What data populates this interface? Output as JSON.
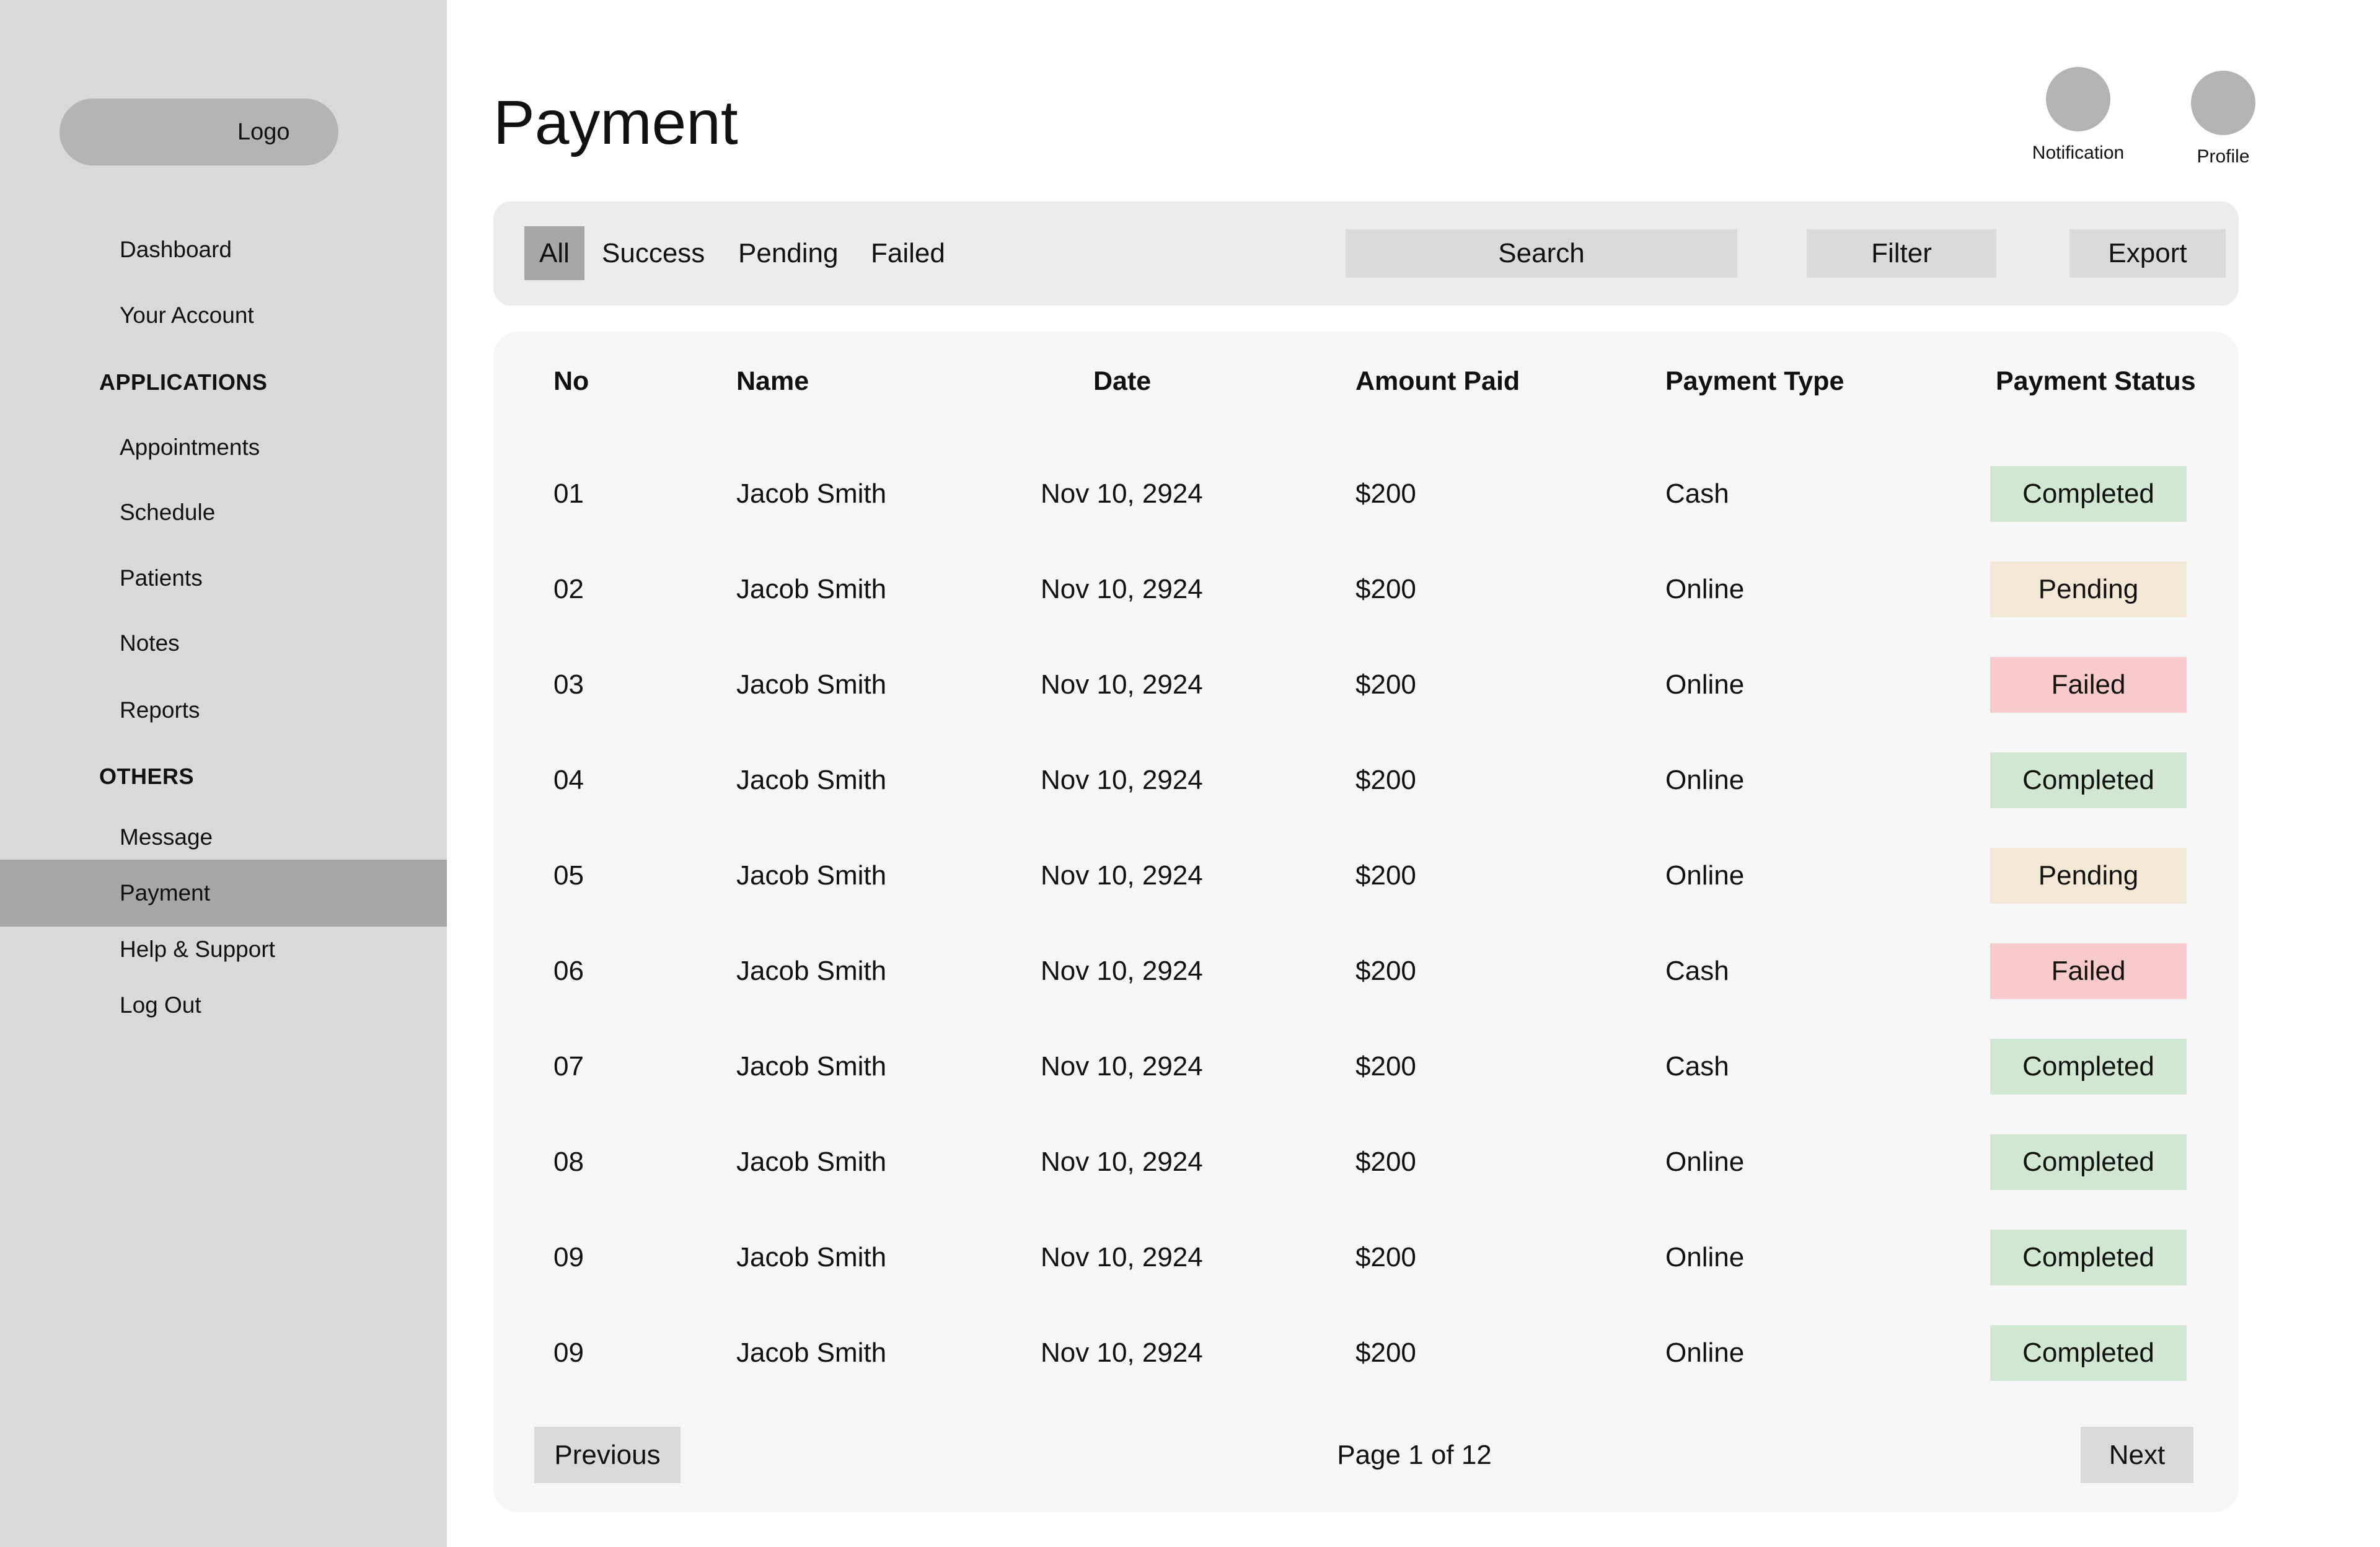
{
  "sidebar": {
    "logo": "Logo",
    "items": [
      {
        "label": "Dashboard"
      },
      {
        "label": "Your Account"
      },
      {
        "label": "Appointments"
      },
      {
        "label": "Schedule"
      },
      {
        "label": "Patients"
      },
      {
        "label": "Notes"
      },
      {
        "label": "Reports"
      },
      {
        "label": "Message"
      },
      {
        "label": "Payment",
        "active": true
      },
      {
        "label": "Help & Support"
      },
      {
        "label": "Log Out"
      }
    ],
    "sections": {
      "applications": "APPLICATIONS",
      "others": "OTHERS"
    }
  },
  "header": {
    "title": "Payment",
    "notification_label": "Notification",
    "profile_label": "Profile"
  },
  "toolbar": {
    "tabs": [
      {
        "label": "All",
        "active": true
      },
      {
        "label": "Success"
      },
      {
        "label": "Pending"
      },
      {
        "label": "Failed"
      }
    ],
    "search_label": "Search",
    "filter_label": "Filter",
    "export_label": "Export"
  },
  "table": {
    "columns": [
      "No",
      "Name",
      "Date",
      "Amount Paid",
      "Payment Type",
      "Payment Status"
    ],
    "rows": [
      {
        "no": "01",
        "name": "Jacob Smith",
        "date": "Nov 10, 2924",
        "amount": "$200",
        "type": "Cash",
        "status": "Completed"
      },
      {
        "no": "02",
        "name": "Jacob Smith",
        "date": "Nov 10, 2924",
        "amount": "$200",
        "type": "Online",
        "status": "Pending"
      },
      {
        "no": "03",
        "name": "Jacob Smith",
        "date": "Nov 10, 2924",
        "amount": "$200",
        "type": "Online",
        "status": "Failed"
      },
      {
        "no": "04",
        "name": "Jacob Smith",
        "date": "Nov 10, 2924",
        "amount": "$200",
        "type": "Online",
        "status": "Completed"
      },
      {
        "no": "05",
        "name": "Jacob Smith",
        "date": "Nov 10, 2924",
        "amount": "$200",
        "type": "Online",
        "status": "Pending"
      },
      {
        "no": "06",
        "name": "Jacob Smith",
        "date": "Nov 10, 2924",
        "amount": "$200",
        "type": "Cash",
        "status": "Failed"
      },
      {
        "no": "07",
        "name": "Jacob Smith",
        "date": "Nov 10, 2924",
        "amount": "$200",
        "type": "Cash",
        "status": "Completed"
      },
      {
        "no": "08",
        "name": "Jacob Smith",
        "date": "Nov 10, 2924",
        "amount": "$200",
        "type": "Online",
        "status": "Completed"
      },
      {
        "no": "09",
        "name": "Jacob Smith",
        "date": "Nov 10, 2924",
        "amount": "$200",
        "type": "Online",
        "status": "Completed"
      },
      {
        "no": "09",
        "name": "Jacob Smith",
        "date": "Nov 10, 2924",
        "amount": "$200",
        "type": "Online",
        "status": "Completed"
      }
    ]
  },
  "pagination": {
    "previous_label": "Previous",
    "page_text": "Page 1 of 12",
    "next_label": "Next"
  },
  "colors": {
    "sidebar_bg": "#d9d9d9",
    "sidebar_active": "#a6a6a6",
    "status_completed": "#d1e6d3",
    "status_pending": "#f3e8d5",
    "status_failed": "#f8cacb"
  }
}
